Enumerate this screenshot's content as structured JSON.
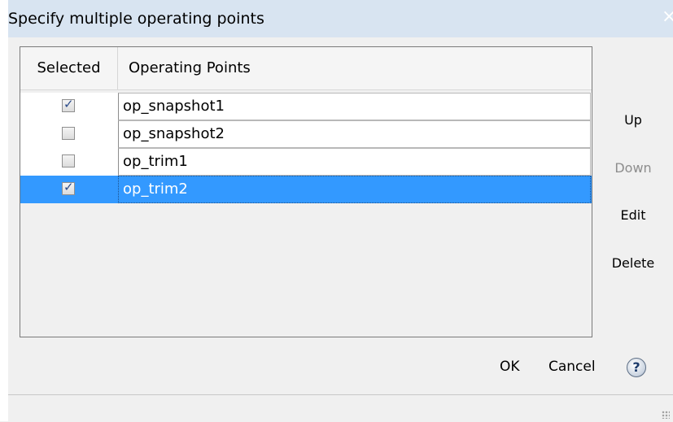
{
  "dialog": {
    "title": "Specify multiple operating points",
    "close_glyph": "×"
  },
  "table": {
    "headers": [
      "Selected",
      "Operating Points"
    ],
    "rows": [
      {
        "name": "op_snapshot1",
        "selected": true
      },
      {
        "name": "op_snapshot2",
        "selected": false
      },
      {
        "name": "op_trim1",
        "selected": false
      },
      {
        "name": "op_trim2",
        "selected": true
      }
    ],
    "highlighted_row_index": 3
  },
  "side_buttons": {
    "up": "Up",
    "down": "Down",
    "edit": "Edit",
    "delete": "Delete"
  },
  "footer": {
    "ok": "OK",
    "cancel": "Cancel",
    "help_glyph": "?"
  },
  "icons": {
    "checkmark": "check-icon",
    "help": "help-icon",
    "close": "close-icon",
    "resize": "resize-grip-icon"
  },
  "colors": {
    "title_bar": "#d8e4f1",
    "selection": "#3399ff",
    "disabled_text": "#8d8d8d"
  }
}
